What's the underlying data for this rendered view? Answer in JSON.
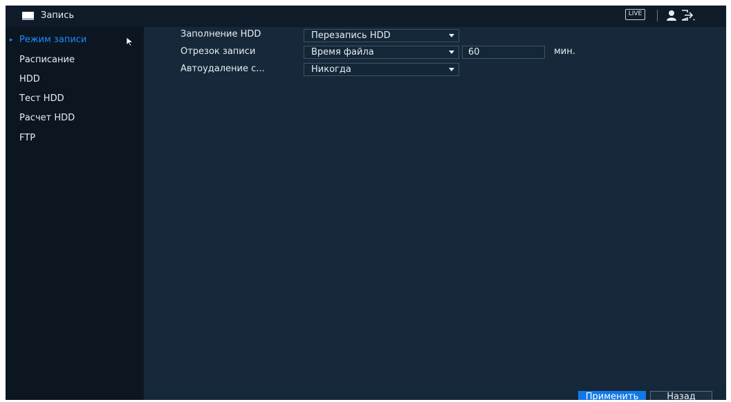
{
  "header": {
    "title": "Запись",
    "live_label": "LIVE",
    "icons": {
      "section": "hdd-record-icon",
      "user": "user-icon",
      "logout": "logout-icon"
    }
  },
  "sidebar": {
    "items": [
      {
        "label": "Режим записи",
        "active": true
      },
      {
        "label": "Расписание"
      },
      {
        "label": "HDD"
      },
      {
        "label": "Тест HDD"
      },
      {
        "label": "Расчет HDD"
      },
      {
        "label": "FTP"
      }
    ]
  },
  "form": {
    "hdd_full": {
      "label": "Заполнение HDD",
      "value": "Перезапись HDD"
    },
    "segment": {
      "label": "Отрезок записи",
      "value": "Время файла",
      "minutes": "60",
      "unit": "мин."
    },
    "auto_delete": {
      "label": "Автоудаление с...",
      "value": "Никогда"
    }
  },
  "buttons": {
    "apply": "Применить",
    "back": "Назад"
  },
  "colors": {
    "accent": "#1f8bff",
    "apply_bg": "#1178e8",
    "panel_bg": "#17283a",
    "sidebar_bg": "#0c1621"
  }
}
